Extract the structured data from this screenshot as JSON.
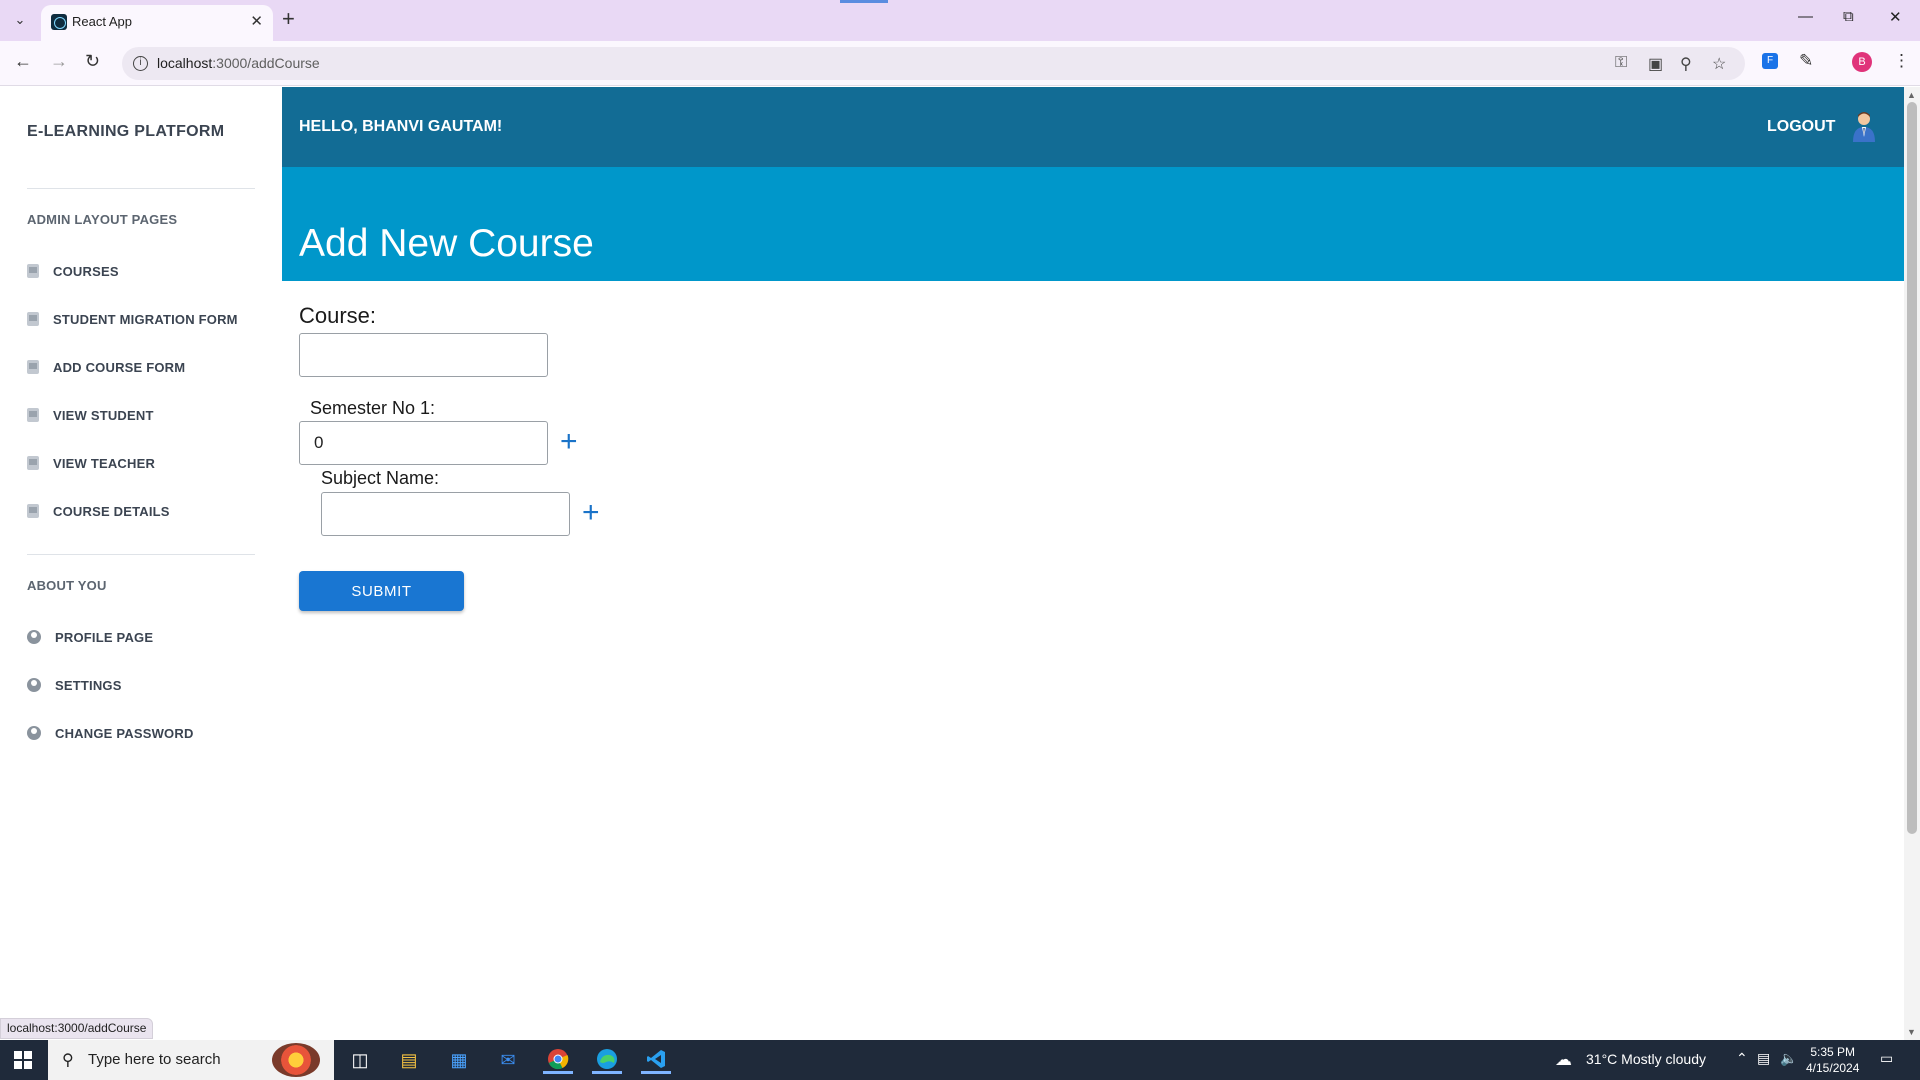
{
  "browser": {
    "tab_title": "React App",
    "url_host": "localhost",
    "url_rest": ":3000/addCourse",
    "profile_initial": "B",
    "status_url": "localhost:3000/addCourse"
  },
  "sidebar": {
    "brand": "E-LEARNING PLATFORM",
    "admin_title": "ADMIN LAYOUT PAGES",
    "admin_items": [
      {
        "label": "COURSES"
      },
      {
        "label": "STUDENT MIGRATION FORM"
      },
      {
        "label": "ADD COURSE FORM"
      },
      {
        "label": "VIEW STUDENT"
      },
      {
        "label": "VIEW TEACHER"
      },
      {
        "label": "COURSE DETAILS"
      }
    ],
    "about_title": "ABOUT YOU",
    "about_items": [
      {
        "label": "PROFILE PAGE"
      },
      {
        "label": "SETTINGS"
      },
      {
        "label": "CHANGE PASSWORD"
      }
    ]
  },
  "header": {
    "greeting": "HELLO, BHANVI GAUTAM!",
    "logout": "LOGOUT"
  },
  "hero": {
    "title": "Add New Course"
  },
  "form": {
    "course_label": "Course:",
    "course_value": "",
    "semester_label": "Semester No 1:",
    "semester_value": "0",
    "subject_label": "Subject Name:",
    "subject_value": "",
    "submit_label": "SUBMIT"
  },
  "taskbar": {
    "search_placeholder": "Type here to search",
    "weather": "31°C  Mostly cloudy",
    "time": "5:35 PM",
    "date": "4/15/2024"
  },
  "colors": {
    "topnav": "#126c95",
    "hero": "#0097ca",
    "submit": "#1976d2"
  }
}
